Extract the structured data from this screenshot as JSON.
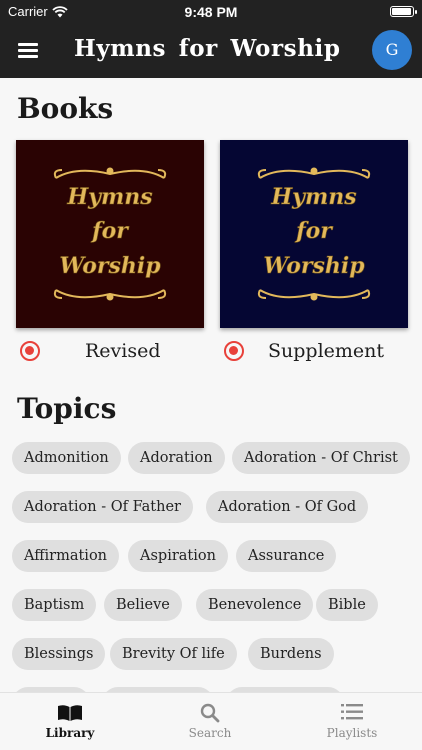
{
  "status": {
    "carrier": "Carrier",
    "time": "9:48 PM",
    "battery_level": 0.95
  },
  "header": {
    "title": "Hymns for Worship",
    "avatar_initial": "G"
  },
  "books_section": {
    "title": "Books",
    "books": [
      {
        "cover_lines": [
          "Hymns",
          "for",
          "Worship"
        ],
        "label": "Revised",
        "cover_color": "#2a0303"
      },
      {
        "cover_lines": [
          "Hymns",
          "for",
          "Worship"
        ],
        "label": "Supplement",
        "cover_color": "#050633"
      }
    ]
  },
  "topics_section": {
    "title": "Topics",
    "chips": [
      "Admonition",
      "Adoration",
      "Adoration - Of Christ",
      "Adoration - Of Father",
      "Adoration - Of God",
      "Affirmation",
      "Aspiration",
      "Assurance",
      "Baptism",
      "Believe",
      "Benevolence",
      "Bible",
      "Blessings",
      "Brevity Of life",
      "Burdens"
    ]
  },
  "tabs": [
    {
      "label": "Library",
      "icon": "book-icon",
      "active": true
    },
    {
      "label": "Search",
      "icon": "search-icon",
      "active": false
    },
    {
      "label": "Playlists",
      "icon": "playlist-icon",
      "active": false
    }
  ],
  "colors": {
    "bar": "#222222",
    "radio": "#e8413a",
    "avatar": "#2f7fd3",
    "chip": "#dfdfdf",
    "gold": "#e2b85b"
  }
}
